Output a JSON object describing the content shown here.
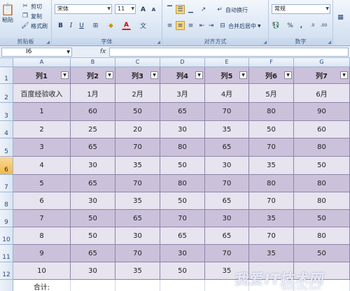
{
  "ribbon": {
    "clipboard": {
      "label": "剪贴板",
      "paste": "粘贴",
      "cut": "剪切",
      "copy": "复制",
      "format_painter": "格式刷"
    },
    "font": {
      "label": "字体",
      "name": "宋体",
      "size": "11",
      "bold": "B",
      "italic": "I",
      "underline": "U",
      "grow": "A",
      "shrink": "A"
    },
    "alignment": {
      "label": "对齐方式",
      "wrap_text": "自动换行",
      "merge_center": "合并后居中"
    },
    "number": {
      "label": "数字",
      "format": "常规",
      "percent": "%",
      "comma": ",",
      "inc_decimal": ".0",
      "dec_decimal": ".00"
    }
  },
  "formula_bar": {
    "name_box": "I6",
    "fx": "fx",
    "content": ""
  },
  "columns": [
    "A",
    "B",
    "C",
    "D",
    "E",
    "F",
    "G"
  ],
  "rows": [
    "1",
    "2",
    "3",
    "4",
    "5",
    "6",
    "7",
    "8",
    "9",
    "10",
    "11",
    "12"
  ],
  "selected_cell": {
    "column": "I",
    "row": "6"
  },
  "table": {
    "headers": [
      "列1",
      "列2",
      "列3",
      "列4",
      "列5",
      "列6",
      "列7"
    ],
    "row2": [
      "百度经验收入",
      "1月",
      "2月",
      "3月",
      "4月",
      "5月",
      "6月"
    ],
    "data": [
      [
        "1",
        "60",
        "50",
        "65",
        "70",
        "80",
        "90"
      ],
      [
        "2",
        "25",
        "20",
        "30",
        "35",
        "50",
        "60"
      ],
      [
        "3",
        "65",
        "70",
        "80",
        "65",
        "70",
        "80"
      ],
      [
        "4",
        "30",
        "35",
        "50",
        "30",
        "35",
        "50"
      ],
      [
        "5",
        "65",
        "70",
        "80",
        "70",
        "80",
        "80"
      ],
      [
        "6",
        "30",
        "35",
        "50",
        "65",
        "70",
        "80"
      ],
      [
        "7",
        "50",
        "65",
        "70",
        "30",
        "35",
        "50"
      ],
      [
        "8",
        "50",
        "30",
        "65",
        "65",
        "70",
        "80"
      ],
      [
        "9",
        "65",
        "70",
        "30",
        "70",
        "35",
        "50"
      ],
      [
        "10",
        "30",
        "35",
        "50",
        "35",
        "",
        ""
      ]
    ],
    "total_label": "合计:"
  },
  "watermark": {
    "main": "我爱IT技术网",
    "sub": "www.52ij.com"
  },
  "colors": {
    "band_dark": "#cbc1da",
    "band_light": "#e7e3ef",
    "ribbon": "#dce7f5"
  }
}
